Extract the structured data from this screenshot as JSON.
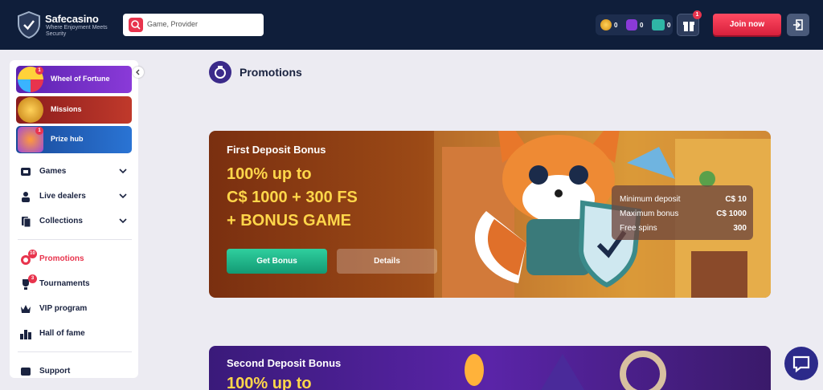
{
  "header": {
    "brand": "Safecasino",
    "tagline": "Where Enjoyment Meets Security",
    "search_placeholder": "Game, Provider",
    "coins": [
      {
        "icon": "coin-icon",
        "value": "0"
      },
      {
        "icon": "free-spins-icon",
        "value": "0"
      },
      {
        "icon": "bonus-bucks-icon",
        "value": "0"
      }
    ],
    "gift_badge": "1",
    "join_label": "Join now"
  },
  "sidebar": {
    "promo_cards": [
      {
        "label": "Wheel of Fortune",
        "badge": "1",
        "color": "#6a2bc4"
      },
      {
        "label": "Missions",
        "color": "#b0282a"
      },
      {
        "label": "Prize hub",
        "badge": "1",
        "color": "#1d5fb8"
      }
    ],
    "menu": [
      {
        "label": "Games",
        "expandable": true
      },
      {
        "label": "Live dealers",
        "expandable": true
      },
      {
        "label": "Collections",
        "expandable": true
      }
    ],
    "secondary": [
      {
        "label": "Promotions",
        "badge": "10",
        "active": true
      },
      {
        "label": "Tournaments",
        "badge": "3"
      },
      {
        "label": "VIP program"
      },
      {
        "label": "Hall of fame"
      }
    ],
    "support_label": "Support"
  },
  "main": {
    "section_title": "Promotions",
    "banner1": {
      "subtitle": "First Deposit Bonus",
      "headline_lines": [
        "100% up to",
        "C$ 1000 + 300 FS",
        "+ BONUS GAME"
      ],
      "primary_button": "Get Bonus",
      "secondary_button": "Details",
      "info": [
        {
          "key": "Minimum deposit",
          "value": "C$ 10"
        },
        {
          "key": "Maximum bonus",
          "value": "C$ 1000"
        },
        {
          "key": "Free spins",
          "value": "300"
        }
      ]
    },
    "banner2": {
      "subtitle": "Second Deposit Bonus",
      "headline": "100% up to"
    }
  },
  "colors": {
    "header_bg": "#0f1e3a",
    "accent_red": "#e8344d",
    "accent_green": "#1fb489",
    "headline_yellow": "#ffd64a"
  }
}
